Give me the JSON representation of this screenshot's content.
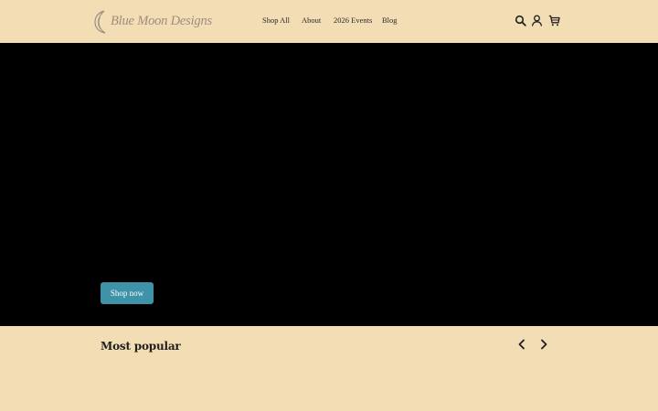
{
  "brand": {
    "name": "Blue Moon Designs",
    "logo_icon": "crescent-moon-icon",
    "logo_color": "#9c8e7f"
  },
  "nav": {
    "items": [
      {
        "label": "Shop All"
      },
      {
        "label": "About"
      },
      {
        "label": "2026 Events"
      },
      {
        "label": "Blog"
      }
    ]
  },
  "header_icons": [
    "search-icon",
    "account-icon",
    "cart-icon"
  ],
  "hero": {
    "background": "#000000",
    "cta_label": "Shop now",
    "cta_color": "#3e93a8"
  },
  "popular": {
    "title": "Most popular",
    "prev_icon": "chevron-left-icon",
    "next_icon": "chevron-right-icon"
  },
  "colors": {
    "page_background": "#f3ddb4"
  }
}
